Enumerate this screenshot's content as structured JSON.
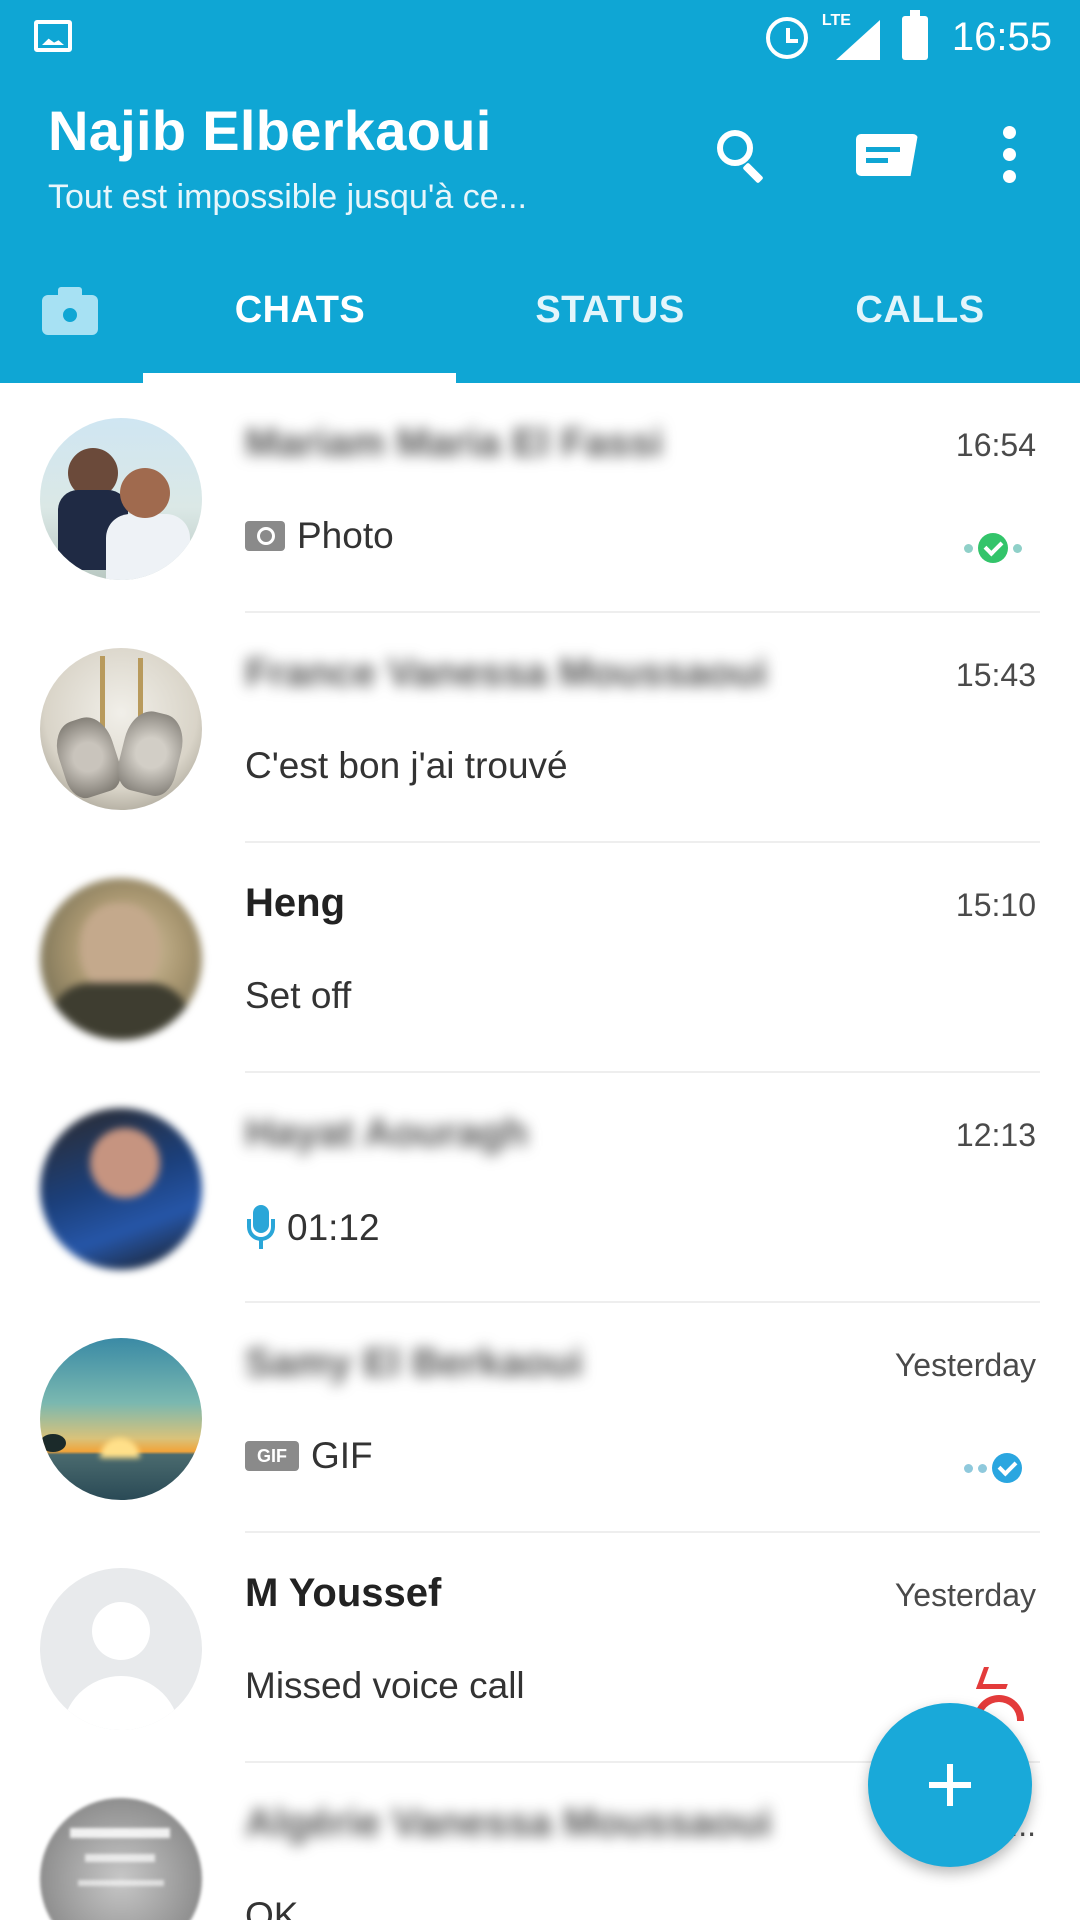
{
  "status_bar": {
    "network": "LTE",
    "time": "16:55"
  },
  "header": {
    "title": "Najib Elberkaoui",
    "subtitle": "Tout est impossible jusqu'à ce..."
  },
  "tabs": [
    {
      "label": "CHATS",
      "selected": true
    },
    {
      "label": "STATUS",
      "selected": false
    },
    {
      "label": "CALLS",
      "selected": false
    }
  ],
  "chats": [
    {
      "name": "Mariam Maria El Fassi",
      "name_blurred": true,
      "time": "16:54",
      "message": "Photo",
      "message_icon": "photo-icon",
      "status": "read-green"
    },
    {
      "name": "France Vanessa Moussaoui",
      "name_blurred": true,
      "time": "15:43",
      "message": "C'est bon j'ai trouvé"
    },
    {
      "name": "Heng",
      "name_blurred": false,
      "time": "15:10",
      "message": "Set off"
    },
    {
      "name": "Hayat Aouragh",
      "name_blurred": true,
      "time": "12:13",
      "message": "01:12",
      "message_icon": "mic-icon"
    },
    {
      "name": "Samy El Berkaoui",
      "name_blurred": true,
      "time": "Yesterday",
      "message": "GIF",
      "message_icon": "gif-icon",
      "status": "read-blue"
    },
    {
      "name": "M Youssef",
      "name_blurred": false,
      "time": "Yesterday",
      "message": "Missed voice call",
      "status": "missed-call"
    },
    {
      "name": "Algérie Vanessa Moussaoui",
      "name_blurred": true,
      "time": "...",
      "message": "OK"
    }
  ],
  "fab": {
    "icon": "plus-icon"
  },
  "colors": {
    "primary": "#0fa6d4",
    "read_green": "#33c46a",
    "read_blue": "#2aa6e0",
    "missed": "#e33b3b"
  }
}
